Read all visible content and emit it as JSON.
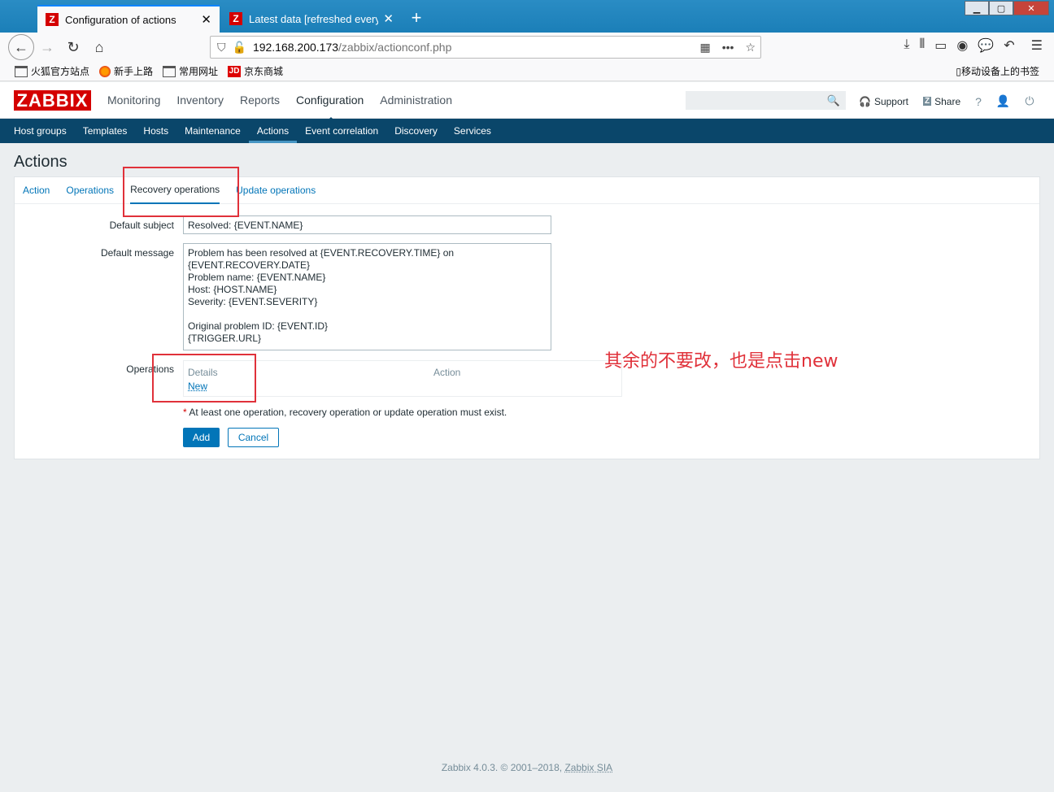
{
  "browser": {
    "tabs": [
      {
        "title": "Configuration of actions",
        "active": true
      },
      {
        "title": "Latest data [refreshed every",
        "active": false
      }
    ],
    "new_tab_label": "+",
    "url_host": "192.168.200.173",
    "url_path": "/zabbix/actionconf.php",
    "bookmarks": [
      "火狐官方站点",
      "新手上路",
      "常用网址",
      "京东商城"
    ],
    "mobile_bookmarks": "移动设备上的书签"
  },
  "header": {
    "logo": "ZABBIX",
    "menu": [
      "Monitoring",
      "Inventory",
      "Reports",
      "Configuration",
      "Administration"
    ],
    "support": "Support",
    "share": "Share",
    "help": "?"
  },
  "submenu": [
    "Host groups",
    "Templates",
    "Hosts",
    "Maintenance",
    "Actions",
    "Event correlation",
    "Discovery",
    "Services"
  ],
  "page": {
    "title": "Actions",
    "tabs": [
      "Action",
      "Operations",
      "Recovery operations",
      "Update operations"
    ],
    "form": {
      "subject_label": "Default subject",
      "subject_value": "Resolved: {EVENT.NAME}",
      "message_label": "Default message",
      "message_value": "Problem has been resolved at {EVENT.RECOVERY.TIME} on\n{EVENT.RECOVERY.DATE}\nProblem name: {EVENT.NAME}\nHost: {HOST.NAME}\nSeverity: {EVENT.SEVERITY}\n\nOriginal problem ID: {EVENT.ID}\n{TRIGGER.URL}",
      "operations_label": "Operations",
      "col_details": "Details",
      "col_action": "Action",
      "new_link": "New",
      "required_star": "*",
      "required_note": "At least one operation, recovery operation or update operation must exist.",
      "add_button": "Add",
      "cancel_button": "Cancel"
    }
  },
  "annotation": "其余的不要改，也是点击new",
  "footer": {
    "text": "Zabbix 4.0.3. © 2001–2018,",
    "link": "Zabbix SIA"
  }
}
